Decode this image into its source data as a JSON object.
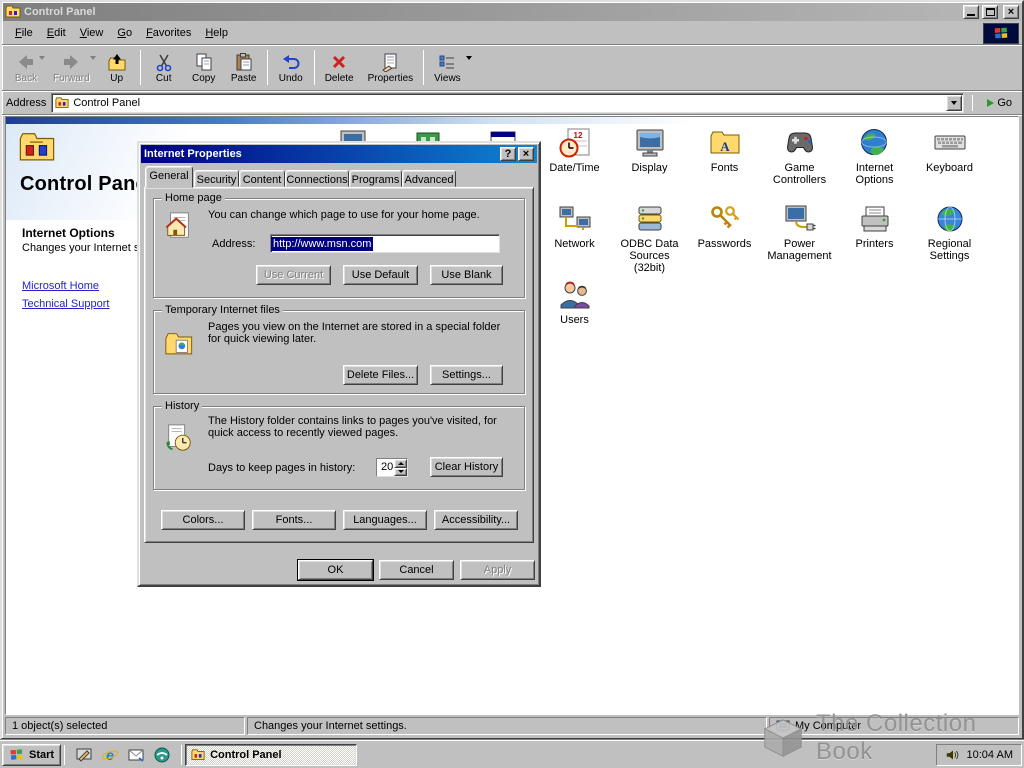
{
  "window": {
    "title": "Control Panel",
    "menu": [
      "File",
      "Edit",
      "View",
      "Go",
      "Favorites",
      "Help"
    ],
    "toolbar": {
      "back": "Back",
      "forward": "Forward",
      "up": "Up",
      "cut": "Cut",
      "copy": "Copy",
      "paste": "Paste",
      "undo": "Undo",
      "delete": "Delete",
      "properties": "Properties",
      "views": "Views"
    },
    "address_bar": {
      "label": "Address",
      "value": "Control Panel",
      "go_label": "Go"
    }
  },
  "sidebar": {
    "title": "Control Panel",
    "selected_item": "Internet Options",
    "selected_description": "Changes your Internet settings.",
    "links": [
      "Microsoft Home",
      "Technical Support"
    ]
  },
  "icons": [
    {
      "label": "Date/Time"
    },
    {
      "label": "Display"
    },
    {
      "label": "Fonts"
    },
    {
      "label": "Game Controllers"
    },
    {
      "label": "Internet Options"
    },
    {
      "label": "Keyboard"
    },
    {
      "label": "Network"
    },
    {
      "label": "ODBC Data Sources (32bit)"
    },
    {
      "label": "Passwords"
    },
    {
      "label": "Power Management"
    },
    {
      "label": "Printers"
    },
    {
      "label": "Regional Settings"
    },
    {
      "label": "Users"
    }
  ],
  "dialog": {
    "title": "Internet Properties",
    "tabs": [
      "General",
      "Security",
      "Content",
      "Connections",
      "Programs",
      "Advanced"
    ],
    "home_page": {
      "legend": "Home page",
      "text": "You can change which page to use for your home page.",
      "address_label": "Address:",
      "address_value": "http://www.msn.com",
      "use_current": "Use Current",
      "use_default": "Use Default",
      "use_blank": "Use Blank"
    },
    "temp_files": {
      "legend": "Temporary Internet files",
      "text": "Pages you view on the Internet are stored in a special folder for quick viewing later.",
      "delete_files": "Delete Files...",
      "settings": "Settings..."
    },
    "history": {
      "legend": "History",
      "text": "The History folder contains links to pages you've visited, for quick access to recently viewed pages.",
      "days_label": "Days to keep pages in history:",
      "days_value": "20",
      "clear_history": "Clear History"
    },
    "colors": "Colors...",
    "fonts": "Fonts...",
    "languages": "Languages...",
    "accessibility": "Accessibility...",
    "ok": "OK",
    "cancel": "Cancel",
    "apply": "Apply"
  },
  "statusbar": {
    "objects": "1 object(s) selected",
    "description": "Changes your Internet settings.",
    "zone": "My Computer"
  },
  "taskbar": {
    "start": "Start",
    "task": "Control Panel",
    "time": "10:04 AM",
    "quick_launch": [
      "show-desktop-icon",
      "internet-explorer-icon",
      "outlook-express-icon",
      "channels-icon"
    ]
  },
  "watermark": "The Collection Book"
}
